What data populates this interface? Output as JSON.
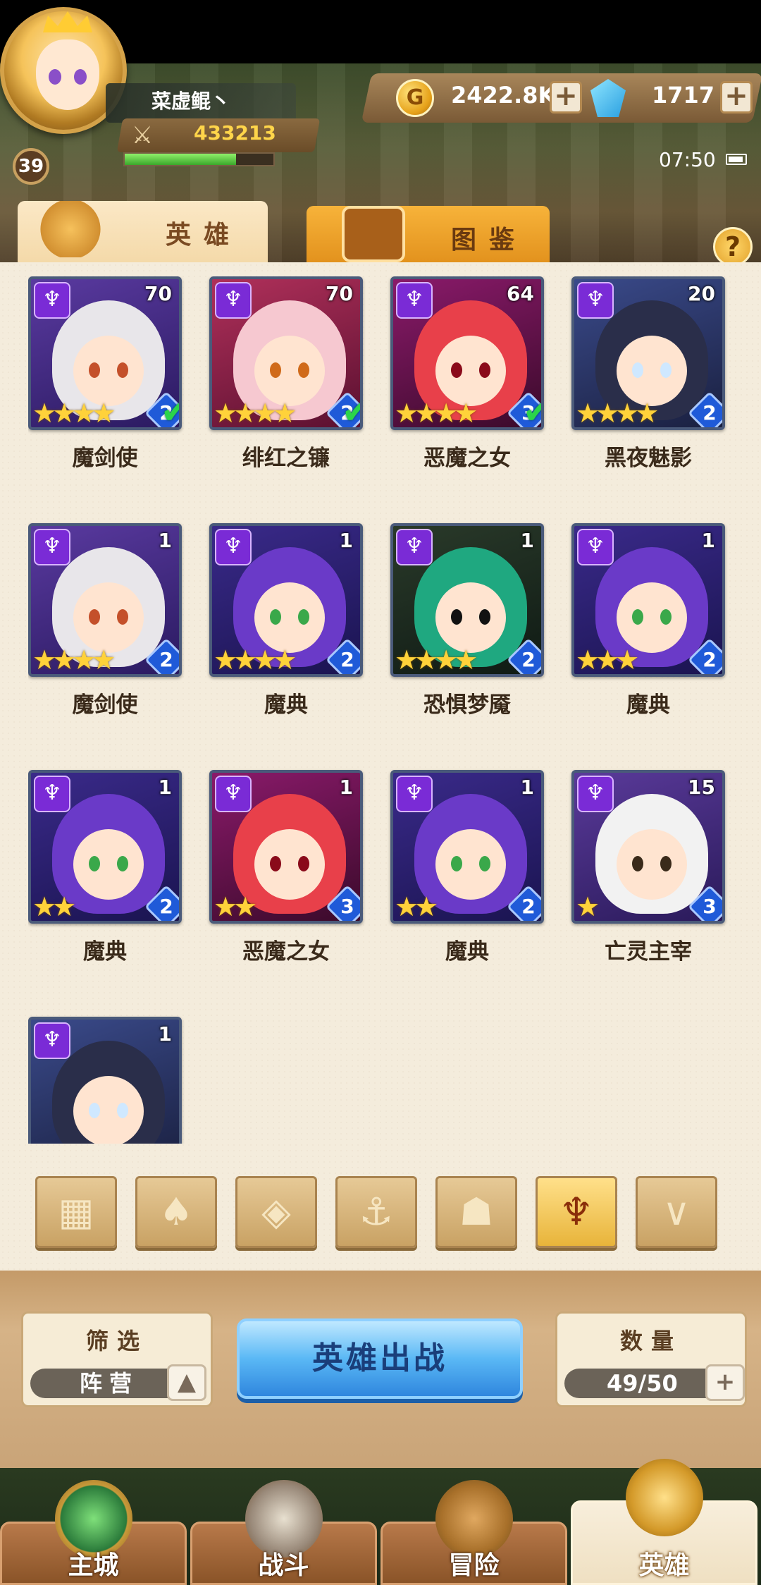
{
  "player": {
    "name": "菜虚鲲丶",
    "level": "39",
    "power": "433213",
    "exp_fraction": 0.75
  },
  "currency": {
    "gold": "2422.8K",
    "gems": "1717"
  },
  "status": {
    "time": "07:50"
  },
  "tabs": {
    "heroes": "英雄",
    "gallery": "图鉴",
    "help": "?"
  },
  "heroes": [
    {
      "name": "魔剑使",
      "level": "70",
      "stars": 4,
      "rank": "2",
      "deployed": true,
      "theme": "white"
    },
    {
      "name": "绯红之镰",
      "level": "70",
      "stars": 4,
      "rank": "2",
      "deployed": true,
      "theme": "pink"
    },
    {
      "name": "恶魔之女",
      "level": "64",
      "stars": 4,
      "rank": "3",
      "deployed": true,
      "theme": "red"
    },
    {
      "name": "黑夜魅影",
      "level": "20",
      "stars": 4,
      "rank": "2",
      "deployed": false,
      "theme": "blue"
    },
    {
      "name": "魔剑使",
      "level": "1",
      "stars": 4,
      "rank": "2",
      "deployed": false,
      "theme": "white"
    },
    {
      "name": "魔典",
      "level": "1",
      "stars": 4,
      "rank": "2",
      "deployed": false,
      "theme": "purple"
    },
    {
      "name": "恐惧梦魇",
      "level": "1",
      "stars": 4,
      "rank": "2",
      "deployed": false,
      "theme": "green"
    },
    {
      "name": "魔典",
      "level": "1",
      "stars": 3,
      "rank": "2",
      "deployed": false,
      "theme": "purple"
    },
    {
      "name": "魔典",
      "level": "1",
      "stars": 2,
      "rank": "2",
      "deployed": false,
      "theme": "purple"
    },
    {
      "name": "恶魔之女",
      "level": "1",
      "stars": 2,
      "rank": "3",
      "deployed": false,
      "theme": "red"
    },
    {
      "name": "魔典",
      "level": "1",
      "stars": 2,
      "rank": "2",
      "deployed": false,
      "theme": "purple"
    },
    {
      "name": "亡灵主宰",
      "level": "15",
      "stars": 1,
      "rank": "3",
      "deployed": false,
      "theme": "wizard"
    },
    {
      "name": "",
      "level": "1",
      "stars": 0,
      "rank": "",
      "deployed": false,
      "theme": "blue"
    }
  ],
  "factions": [
    {
      "icon": "grid-icon",
      "glyph": "▦",
      "active": false
    },
    {
      "icon": "leaf-icon",
      "glyph": "♠",
      "active": false
    },
    {
      "icon": "diamond-icon",
      "glyph": "◈",
      "active": false
    },
    {
      "icon": "anchor-icon",
      "glyph": "⚓",
      "active": false
    },
    {
      "icon": "beast-icon",
      "glyph": "☗",
      "active": false
    },
    {
      "icon": "demon-icon",
      "glyph": "♆",
      "active": true
    },
    {
      "icon": "wing-icon",
      "glyph": "∨",
      "active": false
    }
  ],
  "controls": {
    "filter_title": "筛选",
    "filter_value": "阵营",
    "deploy": "英雄出战",
    "count_title": "数量",
    "count_value": "49/50"
  },
  "nav": [
    {
      "label": "主城",
      "active": false
    },
    {
      "label": "战斗",
      "active": false
    },
    {
      "label": "冒险",
      "active": false
    },
    {
      "label": "英雄",
      "active": true
    }
  ],
  "colors": {
    "accent_blue": "#2f86de",
    "panel": "#f4ecdc",
    "class_purple": "#7a2bd6",
    "star": "#ffd23a",
    "check_green": "#2bd44a"
  }
}
